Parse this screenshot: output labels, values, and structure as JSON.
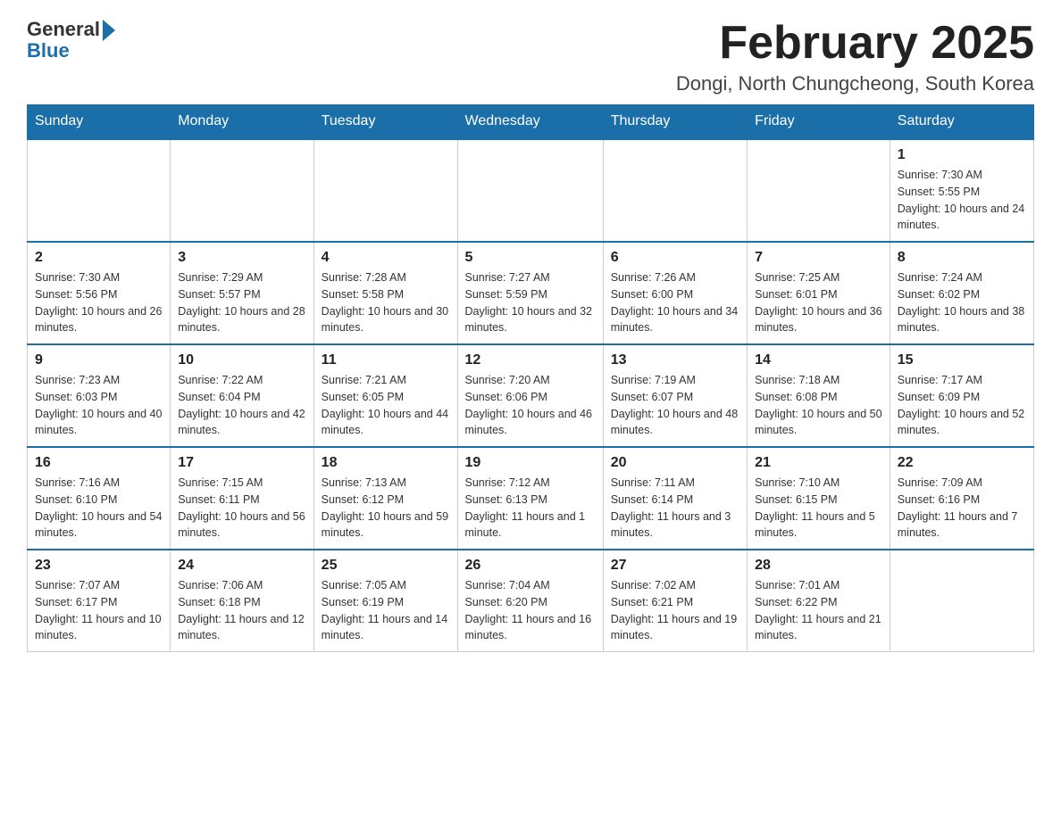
{
  "header": {
    "logo_general": "General",
    "logo_blue": "Blue",
    "month_title": "February 2025",
    "location": "Dongi, North Chungcheong, South Korea"
  },
  "weekdays": [
    "Sunday",
    "Monday",
    "Tuesday",
    "Wednesday",
    "Thursday",
    "Friday",
    "Saturday"
  ],
  "weeks": [
    [
      {
        "day": "",
        "info": ""
      },
      {
        "day": "",
        "info": ""
      },
      {
        "day": "",
        "info": ""
      },
      {
        "day": "",
        "info": ""
      },
      {
        "day": "",
        "info": ""
      },
      {
        "day": "",
        "info": ""
      },
      {
        "day": "1",
        "info": "Sunrise: 7:30 AM\nSunset: 5:55 PM\nDaylight: 10 hours and 24 minutes."
      }
    ],
    [
      {
        "day": "2",
        "info": "Sunrise: 7:30 AM\nSunset: 5:56 PM\nDaylight: 10 hours and 26 minutes."
      },
      {
        "day": "3",
        "info": "Sunrise: 7:29 AM\nSunset: 5:57 PM\nDaylight: 10 hours and 28 minutes."
      },
      {
        "day": "4",
        "info": "Sunrise: 7:28 AM\nSunset: 5:58 PM\nDaylight: 10 hours and 30 minutes."
      },
      {
        "day": "5",
        "info": "Sunrise: 7:27 AM\nSunset: 5:59 PM\nDaylight: 10 hours and 32 minutes."
      },
      {
        "day": "6",
        "info": "Sunrise: 7:26 AM\nSunset: 6:00 PM\nDaylight: 10 hours and 34 minutes."
      },
      {
        "day": "7",
        "info": "Sunrise: 7:25 AM\nSunset: 6:01 PM\nDaylight: 10 hours and 36 minutes."
      },
      {
        "day": "8",
        "info": "Sunrise: 7:24 AM\nSunset: 6:02 PM\nDaylight: 10 hours and 38 minutes."
      }
    ],
    [
      {
        "day": "9",
        "info": "Sunrise: 7:23 AM\nSunset: 6:03 PM\nDaylight: 10 hours and 40 minutes."
      },
      {
        "day": "10",
        "info": "Sunrise: 7:22 AM\nSunset: 6:04 PM\nDaylight: 10 hours and 42 minutes."
      },
      {
        "day": "11",
        "info": "Sunrise: 7:21 AM\nSunset: 6:05 PM\nDaylight: 10 hours and 44 minutes."
      },
      {
        "day": "12",
        "info": "Sunrise: 7:20 AM\nSunset: 6:06 PM\nDaylight: 10 hours and 46 minutes."
      },
      {
        "day": "13",
        "info": "Sunrise: 7:19 AM\nSunset: 6:07 PM\nDaylight: 10 hours and 48 minutes."
      },
      {
        "day": "14",
        "info": "Sunrise: 7:18 AM\nSunset: 6:08 PM\nDaylight: 10 hours and 50 minutes."
      },
      {
        "day": "15",
        "info": "Sunrise: 7:17 AM\nSunset: 6:09 PM\nDaylight: 10 hours and 52 minutes."
      }
    ],
    [
      {
        "day": "16",
        "info": "Sunrise: 7:16 AM\nSunset: 6:10 PM\nDaylight: 10 hours and 54 minutes."
      },
      {
        "day": "17",
        "info": "Sunrise: 7:15 AM\nSunset: 6:11 PM\nDaylight: 10 hours and 56 minutes."
      },
      {
        "day": "18",
        "info": "Sunrise: 7:13 AM\nSunset: 6:12 PM\nDaylight: 10 hours and 59 minutes."
      },
      {
        "day": "19",
        "info": "Sunrise: 7:12 AM\nSunset: 6:13 PM\nDaylight: 11 hours and 1 minute."
      },
      {
        "day": "20",
        "info": "Sunrise: 7:11 AM\nSunset: 6:14 PM\nDaylight: 11 hours and 3 minutes."
      },
      {
        "day": "21",
        "info": "Sunrise: 7:10 AM\nSunset: 6:15 PM\nDaylight: 11 hours and 5 minutes."
      },
      {
        "day": "22",
        "info": "Sunrise: 7:09 AM\nSunset: 6:16 PM\nDaylight: 11 hours and 7 minutes."
      }
    ],
    [
      {
        "day": "23",
        "info": "Sunrise: 7:07 AM\nSunset: 6:17 PM\nDaylight: 11 hours and 10 minutes."
      },
      {
        "day": "24",
        "info": "Sunrise: 7:06 AM\nSunset: 6:18 PM\nDaylight: 11 hours and 12 minutes."
      },
      {
        "day": "25",
        "info": "Sunrise: 7:05 AM\nSunset: 6:19 PM\nDaylight: 11 hours and 14 minutes."
      },
      {
        "day": "26",
        "info": "Sunrise: 7:04 AM\nSunset: 6:20 PM\nDaylight: 11 hours and 16 minutes."
      },
      {
        "day": "27",
        "info": "Sunrise: 7:02 AM\nSunset: 6:21 PM\nDaylight: 11 hours and 19 minutes."
      },
      {
        "day": "28",
        "info": "Sunrise: 7:01 AM\nSunset: 6:22 PM\nDaylight: 11 hours and 21 minutes."
      },
      {
        "day": "",
        "info": ""
      }
    ]
  ]
}
